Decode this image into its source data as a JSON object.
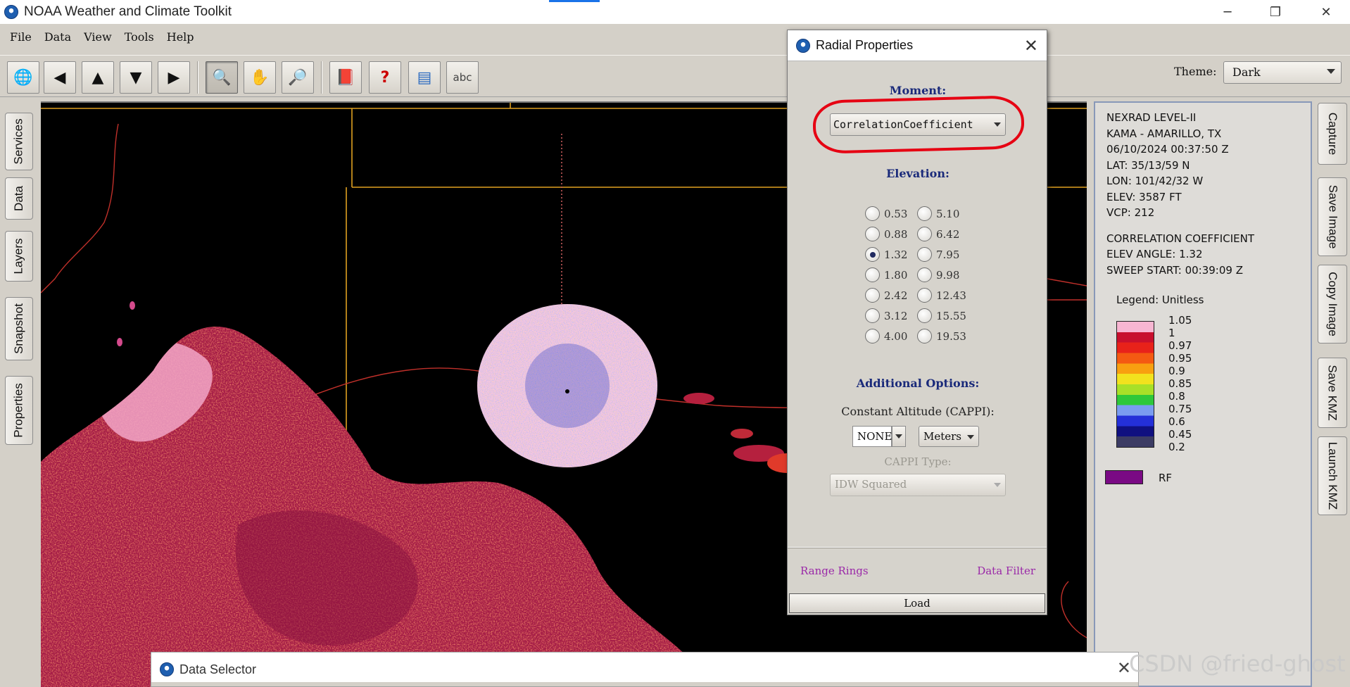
{
  "window": {
    "title": "NOAA Weather and Climate Toolkit",
    "minimize_glyph": "─",
    "restore_glyph": "❐",
    "close_glyph": "✕"
  },
  "menu": [
    "File",
    "Data",
    "View",
    "Tools",
    "Help"
  ],
  "toolbar": {
    "buttons": [
      {
        "icon": "globe-search-icon",
        "glyph": "🌐"
      },
      {
        "icon": "arrow-left-icon",
        "glyph": "◀"
      },
      {
        "icon": "arrow-up-icon",
        "glyph": "▲"
      },
      {
        "icon": "arrow-down-icon",
        "glyph": "▼"
      },
      {
        "icon": "arrow-right-icon",
        "glyph": "▶"
      },
      {
        "icon": "zoom-in-icon",
        "glyph": "🔍"
      },
      {
        "icon": "pan-hand-icon",
        "glyph": "✋"
      },
      {
        "icon": "zoom-out-icon",
        "glyph": "🔎"
      },
      {
        "icon": "bookmark-icon",
        "glyph": "📕"
      },
      {
        "icon": "identify-icon",
        "glyph": "?"
      },
      {
        "icon": "layers-image-icon",
        "glyph": "▤"
      },
      {
        "icon": "label-abc-icon",
        "glyph": "abc"
      }
    ],
    "theme_label": "Theme:",
    "theme_value": "Dark"
  },
  "left_tabs": [
    "Services",
    "Data",
    "Layers",
    "Snapshot",
    "Properties"
  ],
  "right_tabs": [
    "Capture",
    "Save Image",
    "Copy Image",
    "Save KMZ",
    "Launch KMZ"
  ],
  "info": {
    "lines1": [
      "NEXRAD LEVEL-II",
      "KAMA - AMARILLO, TX",
      "06/10/2024 00:37:50 Z",
      "LAT: 35/13/59 N",
      "LON: 101/42/32 W",
      "ELEV: 3587 FT",
      "VCP: 212"
    ],
    "lines2": [
      "CORRELATION COEFFICIENT",
      "ELEV ANGLE: 1.32",
      "SWEEP START: 00:39:09 Z"
    ],
    "legend_title": "Legend: Unitless",
    "legend_labels": [
      "1.05",
      "1",
      "0.97",
      "0.95",
      "0.9",
      "0.85",
      "0.8",
      "0.75",
      "0.6",
      "0.45",
      "0.2"
    ],
    "legend_colors": [
      "#f7b6d2",
      "#c8102e",
      "#e8221a",
      "#f45a12",
      "#f8a010",
      "#f2e21e",
      "#a8e028",
      "#2ec83a",
      "#7a9cf0",
      "#2430d8",
      "#101080",
      "#3c3c64"
    ],
    "rf_label": "RF",
    "rf_color": "#7a0a84"
  },
  "dialog": {
    "title": "Radial Properties",
    "close_glyph": "✕",
    "moment_label": "Moment:",
    "moment_value": "CorrelationCoefficient",
    "elevation_label": "Elevation:",
    "elevations_left": [
      "0.53",
      "0.88",
      "1.32",
      "1.80",
      "2.42",
      "3.12",
      "4.00"
    ],
    "elevations_right": [
      "5.10",
      "6.42",
      "7.95",
      "9.98",
      "12.43",
      "15.55",
      "19.53"
    ],
    "selected_elevation": "1.32",
    "additional_label": "Additional Options:",
    "cappi_label": "Constant Altitude (CAPPI):",
    "cappi_value": "NONE",
    "cappi_unit": "Meters",
    "cappi_type_label": "CAPPI Type:",
    "cappi_type_value": "IDW Squared",
    "range_rings": "Range Rings",
    "data_filter": "Data Filter",
    "load": "Load"
  },
  "data_selector": {
    "title": "Data Selector",
    "close_glyph": "✕"
  },
  "watermark": "CSDN @fried-ghost",
  "colors": {
    "map_background": "#000000",
    "county_lines": "#e0a020",
    "state_lines": "#c0302a",
    "highlight_red": "#e60012",
    "link_purple": "#9a28a8",
    "heading_blue": "#1a2a7a"
  }
}
